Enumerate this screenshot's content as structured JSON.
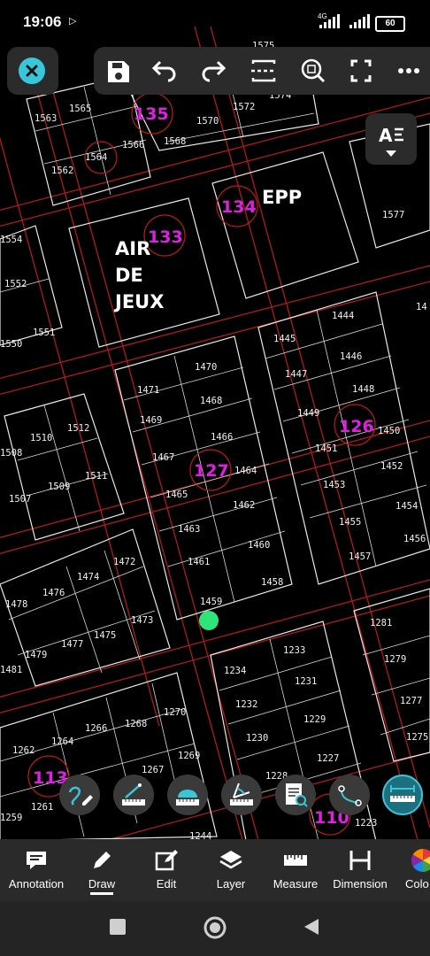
{
  "status": {
    "time": "19:06",
    "network": "4G",
    "battery": "60"
  },
  "labels": {
    "airdejeux": [
      "AIR",
      "DE",
      "JEUX"
    ],
    "epp": "EPP",
    "blocks": [
      "135",
      "134",
      "133",
      "127",
      "126",
      "113",
      "110"
    ]
  },
  "lots": [
    "1575",
    "1565",
    "1563",
    "1574",
    "1570",
    "1572",
    "1566",
    "1568",
    "1564",
    "1562",
    "1577",
    "1554",
    "1552",
    "1551",
    "1550",
    "1444",
    "1445",
    "1446",
    "1447",
    "1448",
    "1449",
    "1450",
    "1451",
    "1452",
    "1453",
    "1454",
    "1455",
    "1456",
    "1457",
    "1470",
    "1471",
    "1468",
    "1469",
    "1466",
    "1467",
    "1464",
    "1465",
    "1462",
    "1463",
    "1460",
    "1461",
    "1458",
    "1459",
    "1512",
    "1510",
    "1508",
    "1511",
    "1509",
    "1507",
    "1472",
    "1474",
    "1476",
    "1478",
    "1473",
    "1475",
    "1477",
    "1479",
    "1481",
    "1281",
    "1279",
    "1277",
    "1275",
    "1234",
    "1233",
    "1231",
    "1232",
    "1229",
    "1230",
    "1227",
    "1228",
    "1223",
    "1270",
    "1268",
    "1266",
    "1269",
    "1264",
    "1262",
    "1267",
    "1261",
    "1259",
    "1244",
    "14"
  ],
  "toolbar": {
    "icons": [
      "save-icon",
      "undo-icon",
      "redo-icon",
      "split-icon",
      "zoom-fit-icon",
      "fullscreen-icon",
      "more-icon"
    ]
  },
  "tools": [
    "sketch-tool",
    "measure-line-tool",
    "measure-area-tool",
    "measure-angle-tool",
    "measure-doc-tool",
    "polyline-tool",
    "measure-distance-tool"
  ],
  "tabs": [
    "Annotation",
    "Draw",
    "Edit",
    "Layer",
    "Measure",
    "Dimension",
    "Colo"
  ],
  "colors": {
    "accent": "#38c6d9",
    "magenta": "#e020e0",
    "grid": "#b01a1a"
  }
}
